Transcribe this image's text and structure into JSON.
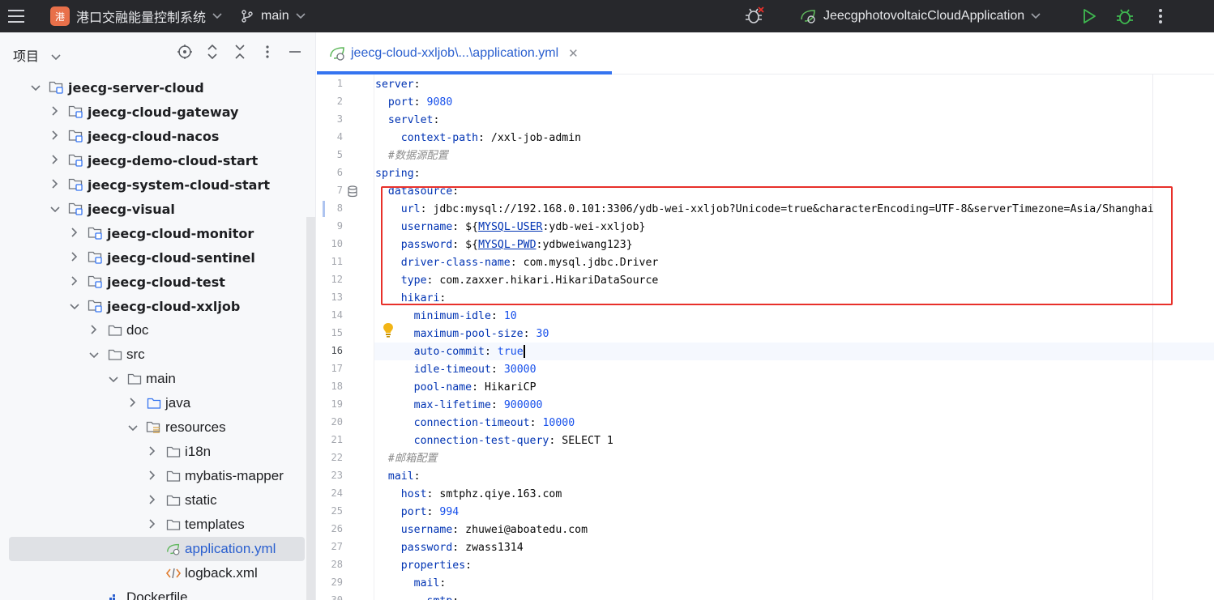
{
  "titlebar": {
    "project_badge": "港",
    "project_name": "港口交融能量控制系统",
    "branch": "main",
    "run_config": "JeecgphotovoltaicCloudApplication"
  },
  "project_panel": {
    "title": "项目",
    "tree": [
      {
        "label": "jeecg-server-cloud",
        "arrow": "open",
        "type": "module",
        "bold": true
      },
      {
        "label": "jeecg-cloud-gateway",
        "arrow": "closed",
        "type": "module",
        "bold": true
      },
      {
        "label": "jeecg-cloud-nacos",
        "arrow": "closed",
        "type": "module",
        "bold": true
      },
      {
        "label": "jeecg-demo-cloud-start",
        "arrow": "closed",
        "type": "module",
        "bold": true
      },
      {
        "label": "jeecg-system-cloud-start",
        "arrow": "closed",
        "type": "module",
        "bold": true
      },
      {
        "label": "jeecg-visual",
        "arrow": "open",
        "type": "module",
        "bold": true
      },
      {
        "label": "jeecg-cloud-monitor",
        "arrow": "closed",
        "type": "module",
        "bold": true
      },
      {
        "label": "jeecg-cloud-sentinel",
        "arrow": "closed",
        "type": "module",
        "bold": true
      },
      {
        "label": "jeecg-cloud-test",
        "arrow": "closed",
        "type": "module",
        "bold": true
      },
      {
        "label": "jeecg-cloud-xxljob",
        "arrow": "open",
        "type": "module",
        "bold": true
      },
      {
        "label": "doc",
        "arrow": "closed",
        "type": "folder",
        "bold": false
      },
      {
        "label": "src",
        "arrow": "open",
        "type": "folder",
        "bold": false
      },
      {
        "label": "main",
        "arrow": "open",
        "type": "folder",
        "bold": false
      },
      {
        "label": "java",
        "arrow": "closed",
        "type": "source",
        "bold": false
      },
      {
        "label": "resources",
        "arrow": "open",
        "type": "resources",
        "bold": false
      },
      {
        "label": "i18n",
        "arrow": "closed",
        "type": "folder",
        "bold": false
      },
      {
        "label": "mybatis-mapper",
        "arrow": "closed",
        "type": "folder",
        "bold": false
      },
      {
        "label": "static",
        "arrow": "closed",
        "type": "folder",
        "bold": false
      },
      {
        "label": "templates",
        "arrow": "closed",
        "type": "folder",
        "bold": false
      },
      {
        "label": "application.yml",
        "arrow": "none",
        "type": "yml",
        "bold": false,
        "selected": true
      },
      {
        "label": "logback.xml",
        "arrow": "none",
        "type": "xml",
        "bold": false
      },
      {
        "label": "Dockerfile",
        "arrow": "none",
        "type": "docker",
        "bold": false
      }
    ]
  },
  "editor": {
    "tab_label": "jeecg-cloud-xxljob\\...\\application.yml",
    "current_line": 16,
    "lines": [
      [
        [
          "k",
          "server"
        ],
        [
          "p",
          ":"
        ]
      ],
      [
        [
          "p",
          "  "
        ],
        [
          "k",
          "port"
        ],
        [
          "p",
          ": "
        ],
        [
          "n",
          "9080"
        ]
      ],
      [
        [
          "p",
          "  "
        ],
        [
          "k",
          "servlet"
        ],
        [
          "p",
          ":"
        ]
      ],
      [
        [
          "p",
          "    "
        ],
        [
          "k",
          "context-path"
        ],
        [
          "p",
          ": /xxl-job-admin"
        ]
      ],
      [
        [
          "p",
          "  "
        ],
        [
          "c",
          "#数据源配置"
        ]
      ],
      [
        [
          "k",
          "spring"
        ],
        [
          "p",
          ":"
        ]
      ],
      [
        [
          "p",
          "  "
        ],
        [
          "k",
          "datasource"
        ],
        [
          "p",
          ":"
        ]
      ],
      [
        [
          "p",
          "    "
        ],
        [
          "k",
          "url"
        ],
        [
          "p",
          ": jdbc:mysql://192.168.0.101:3306/ydb-wei-xxljob?Unicode=true&characterEncoding=UTF-8&serverTimezone=Asia/Shanghai"
        ]
      ],
      [
        [
          "p",
          "    "
        ],
        [
          "k",
          "username"
        ],
        [
          "p",
          ": ${"
        ],
        [
          "ph",
          "MYSQL-USER"
        ],
        [
          "p",
          ":ydb-wei-xxljob}"
        ]
      ],
      [
        [
          "p",
          "    "
        ],
        [
          "k",
          "password"
        ],
        [
          "p",
          ": ${"
        ],
        [
          "ph",
          "MYSQL-PWD"
        ],
        [
          "p",
          ":ydbweiwang123}"
        ]
      ],
      [
        [
          "p",
          "    "
        ],
        [
          "k",
          "driver-class-name"
        ],
        [
          "p",
          ": com.mysql.jdbc.Driver"
        ]
      ],
      [
        [
          "p",
          "    "
        ],
        [
          "k",
          "type"
        ],
        [
          "p",
          ": com.zaxxer.hikari.HikariDataSource"
        ]
      ],
      [
        [
          "p",
          "    "
        ],
        [
          "k",
          "hikari"
        ],
        [
          "p",
          ":"
        ]
      ],
      [
        [
          "p",
          "      "
        ],
        [
          "k",
          "minimum-idle"
        ],
        [
          "p",
          ": "
        ],
        [
          "n",
          "10"
        ]
      ],
      [
        [
          "p",
          "      "
        ],
        [
          "k",
          "maximum-pool-size"
        ],
        [
          "p",
          ": "
        ],
        [
          "n",
          "30"
        ]
      ],
      [
        [
          "p",
          "      "
        ],
        [
          "k",
          "auto-commit"
        ],
        [
          "p",
          ": "
        ],
        [
          "n",
          "true"
        ],
        [
          "caret",
          ""
        ]
      ],
      [
        [
          "p",
          "      "
        ],
        [
          "k",
          "idle-timeout"
        ],
        [
          "p",
          ": "
        ],
        [
          "n",
          "30000"
        ]
      ],
      [
        [
          "p",
          "      "
        ],
        [
          "k",
          "pool-name"
        ],
        [
          "p",
          ": HikariCP"
        ]
      ],
      [
        [
          "p",
          "      "
        ],
        [
          "k",
          "max-lifetime"
        ],
        [
          "p",
          ": "
        ],
        [
          "n",
          "900000"
        ]
      ],
      [
        [
          "p",
          "      "
        ],
        [
          "k",
          "connection-timeout"
        ],
        [
          "p",
          ": "
        ],
        [
          "n",
          "10000"
        ]
      ],
      [
        [
          "p",
          "      "
        ],
        [
          "k",
          "connection-test-query"
        ],
        [
          "p",
          ": SELECT 1"
        ]
      ],
      [
        [
          "p",
          "  "
        ],
        [
          "c",
          "#邮箱配置"
        ]
      ],
      [
        [
          "p",
          "  "
        ],
        [
          "k",
          "mail"
        ],
        [
          "p",
          ":"
        ]
      ],
      [
        [
          "p",
          "    "
        ],
        [
          "k",
          "host"
        ],
        [
          "p",
          ": smtphz.qiye.163.com"
        ]
      ],
      [
        [
          "p",
          "    "
        ],
        [
          "k",
          "port"
        ],
        [
          "p",
          ": "
        ],
        [
          "n",
          "994"
        ]
      ],
      [
        [
          "p",
          "    "
        ],
        [
          "k",
          "username"
        ],
        [
          "p",
          ": zhuwei@aboatedu.com"
        ]
      ],
      [
        [
          "p",
          "    "
        ],
        [
          "k",
          "password"
        ],
        [
          "p",
          ": zwass1314"
        ]
      ],
      [
        [
          "p",
          "    "
        ],
        [
          "k",
          "properties"
        ],
        [
          "p",
          ":"
        ]
      ],
      [
        [
          "p",
          "      "
        ],
        [
          "k",
          "mail"
        ],
        [
          "p",
          ":"
        ]
      ],
      [
        [
          "p",
          "        "
        ],
        [
          "k",
          "smtp"
        ],
        [
          "p",
          ":"
        ]
      ]
    ]
  },
  "icons": {
    "menu": "hamburger-icon",
    "branch": "git-branch-icon",
    "run": "run-icon",
    "debug": "debug-icon",
    "more": "more-vertical-icon",
    "locate": "locate-icon",
    "expand": "expand-all-icon",
    "collapse": "collapse-all-icon",
    "hide": "minimize-icon",
    "bulb": "lightbulb-icon",
    "datasource": "database-icon"
  },
  "colors": {
    "titlebar_bg": "#27282c",
    "accent": "#3574f0",
    "highlight_box": "#e8302a",
    "key": "#0033b3",
    "number": "#1750eb",
    "comment": "#8c8c8c",
    "run_green": "#3fb950"
  }
}
